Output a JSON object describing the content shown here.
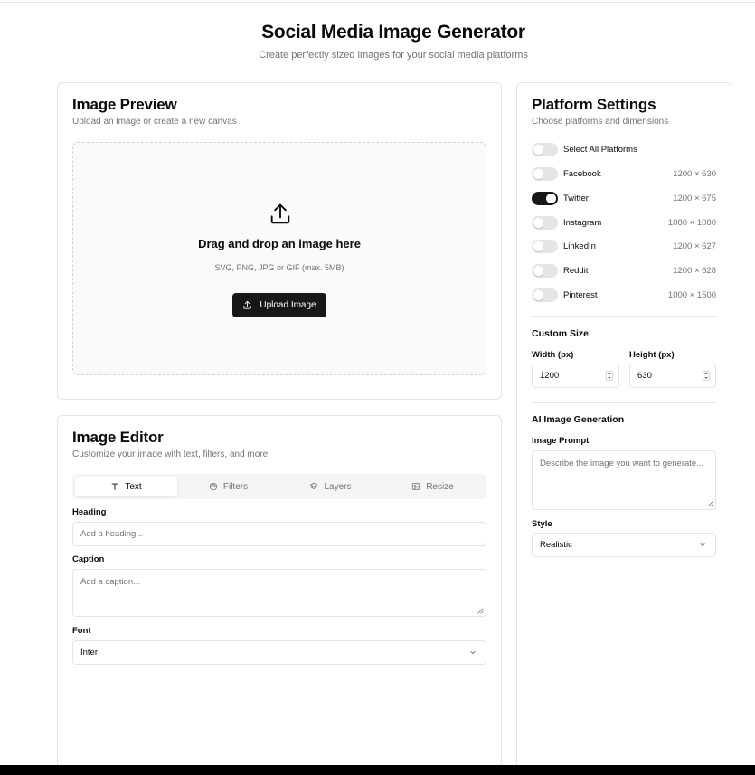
{
  "header": {
    "title": "Social Media Image Generator",
    "subtitle": "Create perfectly sized images for your social media platforms"
  },
  "preview": {
    "title": "Image Preview",
    "subtitle": "Upload an image or create a new canvas",
    "drop_title": "Drag and drop an image here",
    "drop_sub": "SVG, PNG, JPG or GIF (max. 5MB)",
    "upload_label": "Upload Image",
    "upload_icon": "upload-icon"
  },
  "editor": {
    "title": "Image Editor",
    "subtitle": "Customize your image with text, filters, and more",
    "tabs": [
      {
        "label": "Text",
        "icon": "text-icon",
        "active": true
      },
      {
        "label": "Filters",
        "icon": "palette-icon",
        "active": false
      },
      {
        "label": "Layers",
        "icon": "layers-icon",
        "active": false
      },
      {
        "label": "Resize",
        "icon": "image-icon",
        "active": false
      }
    ],
    "heading_label": "Heading",
    "heading_placeholder": "Add a heading...",
    "caption_label": "Caption",
    "caption_placeholder": "Add a caption...",
    "font_label": "Font",
    "font_value": "Inter"
  },
  "platforms": {
    "title": "Platform Settings",
    "subtitle": "Choose platforms and dimensions",
    "select_all_label": "Select All Platforms",
    "select_all_on": false,
    "items": [
      {
        "name": "Facebook",
        "dims": "1200 × 630",
        "on": false
      },
      {
        "name": "Twitter",
        "dims": "1200 × 675",
        "on": true
      },
      {
        "name": "Instagram",
        "dims": "1080 × 1080",
        "on": false
      },
      {
        "name": "LinkedIn",
        "dims": "1200 × 627",
        "on": false
      },
      {
        "name": "Reddit",
        "dims": "1200 × 628",
        "on": false
      },
      {
        "name": "Pinterest",
        "dims": "1000 × 1500",
        "on": false
      }
    ],
    "custom_size_title": "Custom Size",
    "width_label": "Width (px)",
    "width_value": "1200",
    "height_label": "Height (px)",
    "height_value": "630",
    "ai_title": "AI Image Generation",
    "prompt_label": "Image Prompt",
    "prompt_placeholder": "Describe the image you want to generate...",
    "style_label": "Style",
    "style_value": "Realistic"
  },
  "colors": {
    "primary": "#171717",
    "muted_text": "#737373",
    "border": "#e5e5e5",
    "toggle_off": "#e5e5e5"
  }
}
